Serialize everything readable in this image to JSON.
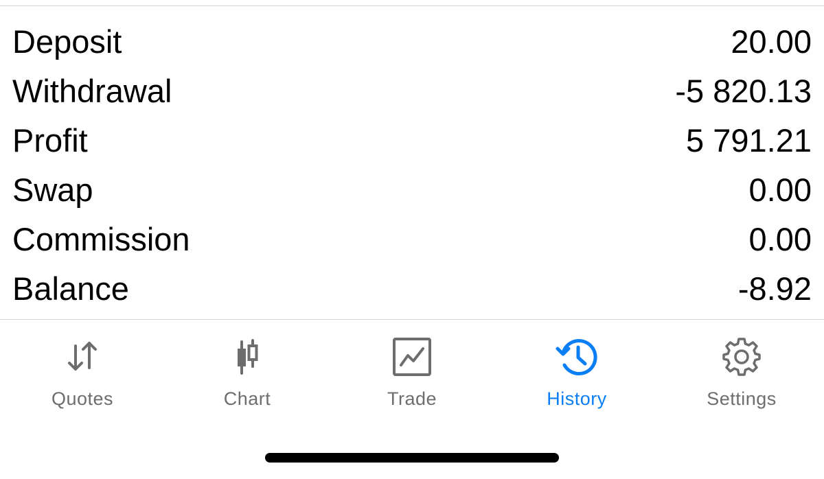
{
  "summary": {
    "rows": [
      {
        "label": "Deposit",
        "value": "20.00"
      },
      {
        "label": "Withdrawal",
        "value": "-5 820.13"
      },
      {
        "label": "Profit",
        "value": "5 791.21"
      },
      {
        "label": "Swap",
        "value": "0.00"
      },
      {
        "label": "Commission",
        "value": "0.00"
      },
      {
        "label": "Balance",
        "value": "-8.92"
      }
    ]
  },
  "tabbar": {
    "tabs": [
      {
        "label": "Quotes",
        "icon": "quotes-arrows-icon",
        "active": false
      },
      {
        "label": "Chart",
        "icon": "candlestick-chart-icon",
        "active": false
      },
      {
        "label": "Trade",
        "icon": "trade-chart-icon",
        "active": false
      },
      {
        "label": "History",
        "icon": "history-clock-icon",
        "active": true
      },
      {
        "label": "Settings",
        "icon": "gear-icon",
        "active": false
      }
    ]
  },
  "colors": {
    "active": "#0a7ff5",
    "inactive": "#6d6d6d",
    "text": "#000000"
  }
}
